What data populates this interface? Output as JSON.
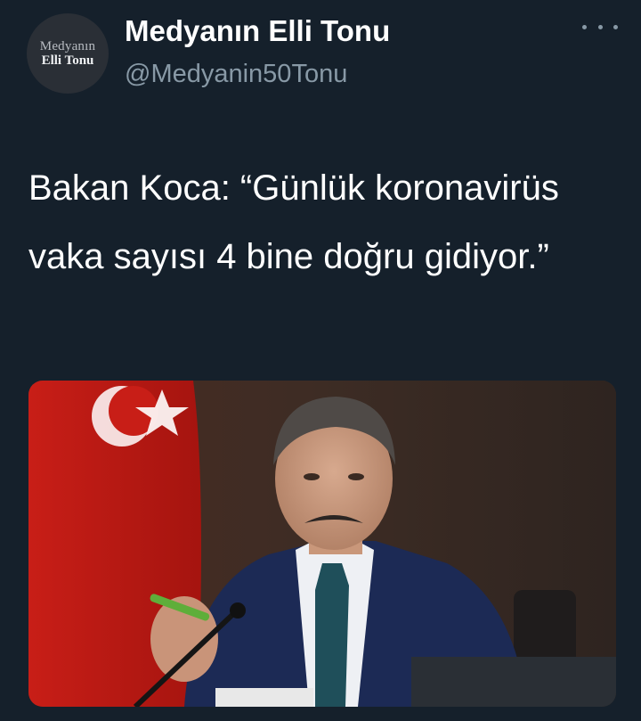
{
  "account": {
    "avatar_text_line1": "Medyanın",
    "avatar_text_line2": "Elli Tonu",
    "display_name": "Medyanın Elli Tonu",
    "handle": "@Medyanin50Tonu"
  },
  "tweet": {
    "text": "Bakan Koca: “Günlük koronavirüs vaka sayısı 4 bine doğru gidiyor.”"
  },
  "icons": {
    "more": "more-options-icon"
  },
  "colors": {
    "background": "#15202b",
    "text": "#ffffff",
    "secondary_text": "#8899a6"
  }
}
